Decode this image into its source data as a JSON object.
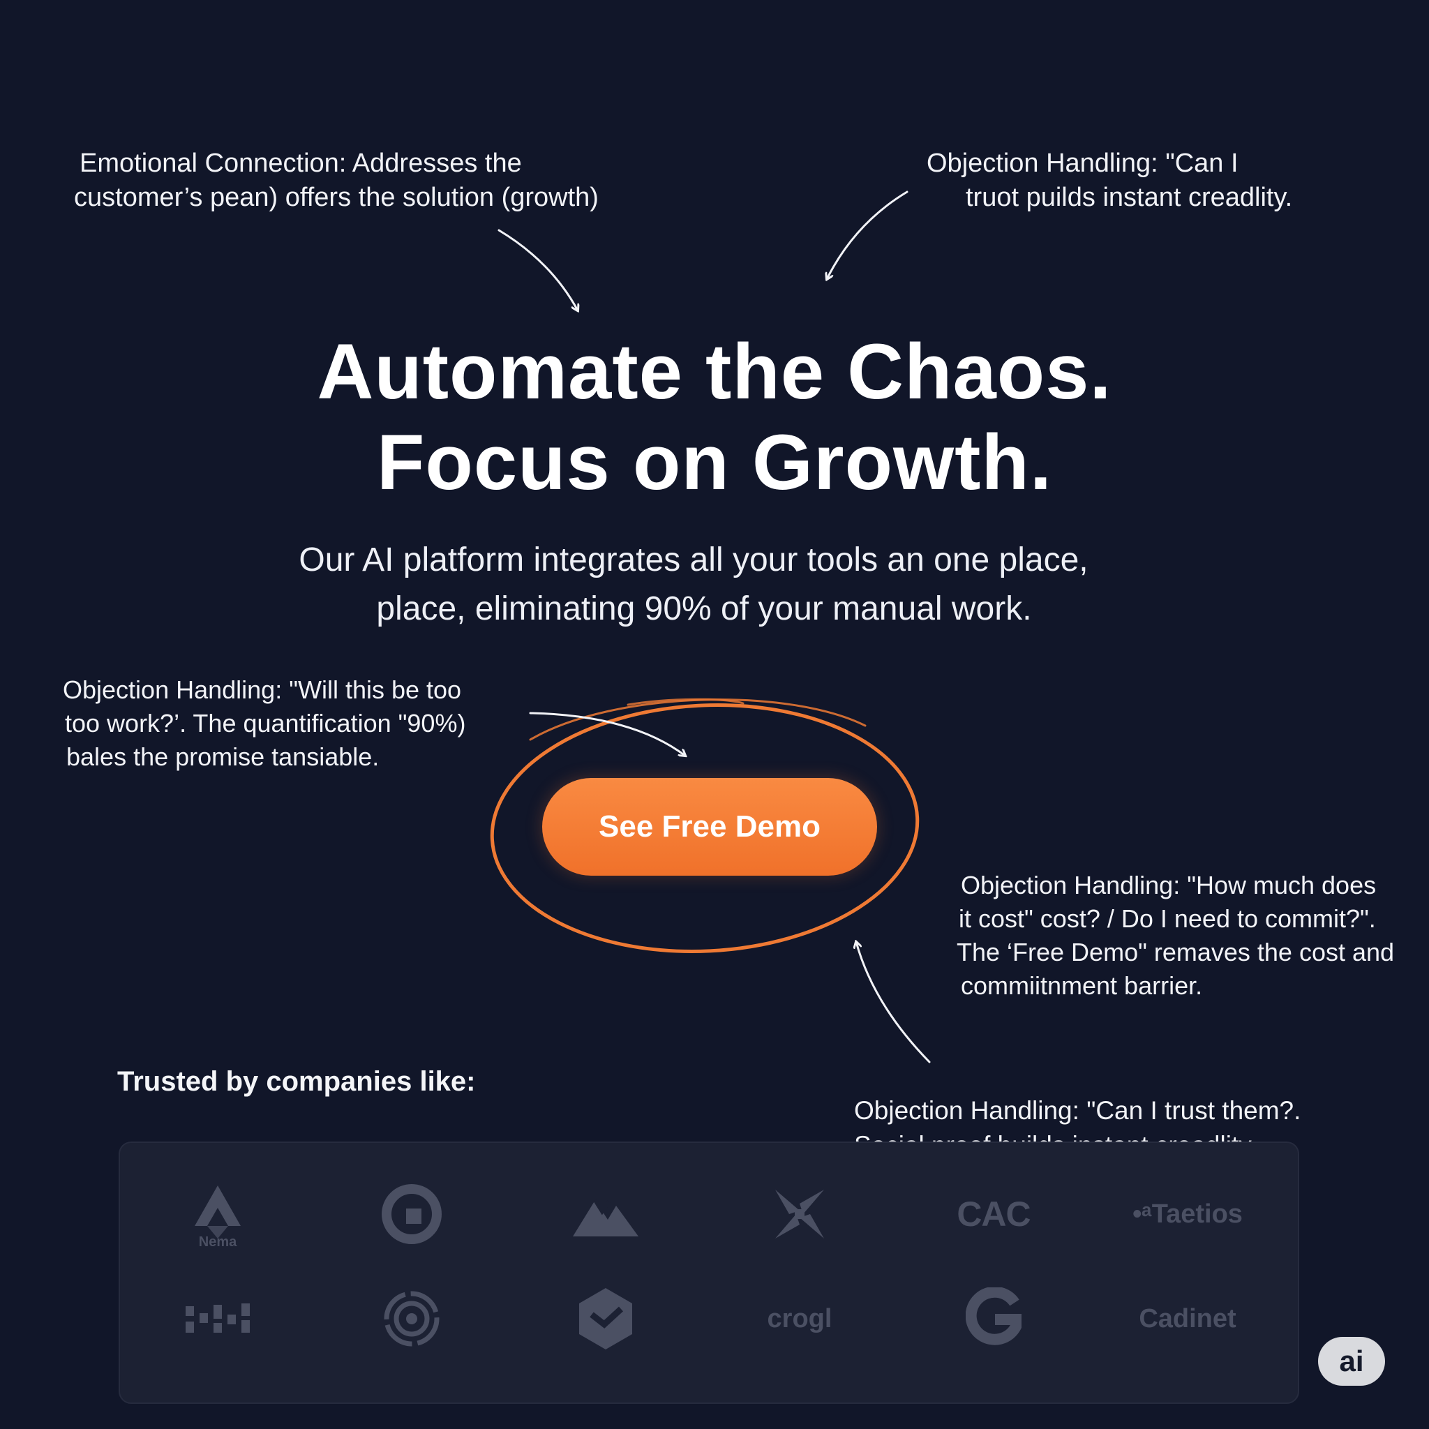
{
  "annotations": {
    "emotional": [
      "Emotional Connection: Addresses the",
      "customer’s pean) offers the solution (growth)"
    ],
    "objection_credibility_top": [
      "Objection Handling: \"Can I",
      "truot puilds instant creadlity."
    ],
    "objection_work": [
      "Objection Handling: \"Will this be too",
      "too work?’. The quantification \"90%)",
      "bales the promise tansiable."
    ],
    "objection_cost": [
      "Objection Handling: \"How much does",
      "it cost\" cost? / Do I need to commit?\".",
      "The ‘Free Demo\" remaves the cost and",
      "commiitnment barrier."
    ],
    "objection_trust": [
      "Objection Handling: \"Can I trust them?.",
      "Social proof builds instant creadlity."
    ]
  },
  "hero": {
    "title_line1": "Automate the Chaos.",
    "title_line2": "Focus on Growth.",
    "subtitle_line1": "Our AI platform integrates all your tools an one place,",
    "subtitle_line2": "place, eliminating 90% of your manual work."
  },
  "cta": {
    "label": "See Free Demo"
  },
  "trusted": {
    "heading": "Trusted by companies like:",
    "wordmarks": {
      "cac": "CAC",
      "taetios": "•ᵃTaetios",
      "crogl": "crogl",
      "cadinet": "Cadinet",
      "caption": "Nema"
    }
  },
  "badge": {
    "label": "ai"
  },
  "colors": {
    "background": "#111629",
    "accent": "#f47a35",
    "logo_gray": "#4b5063",
    "panel": "#1c2133"
  }
}
